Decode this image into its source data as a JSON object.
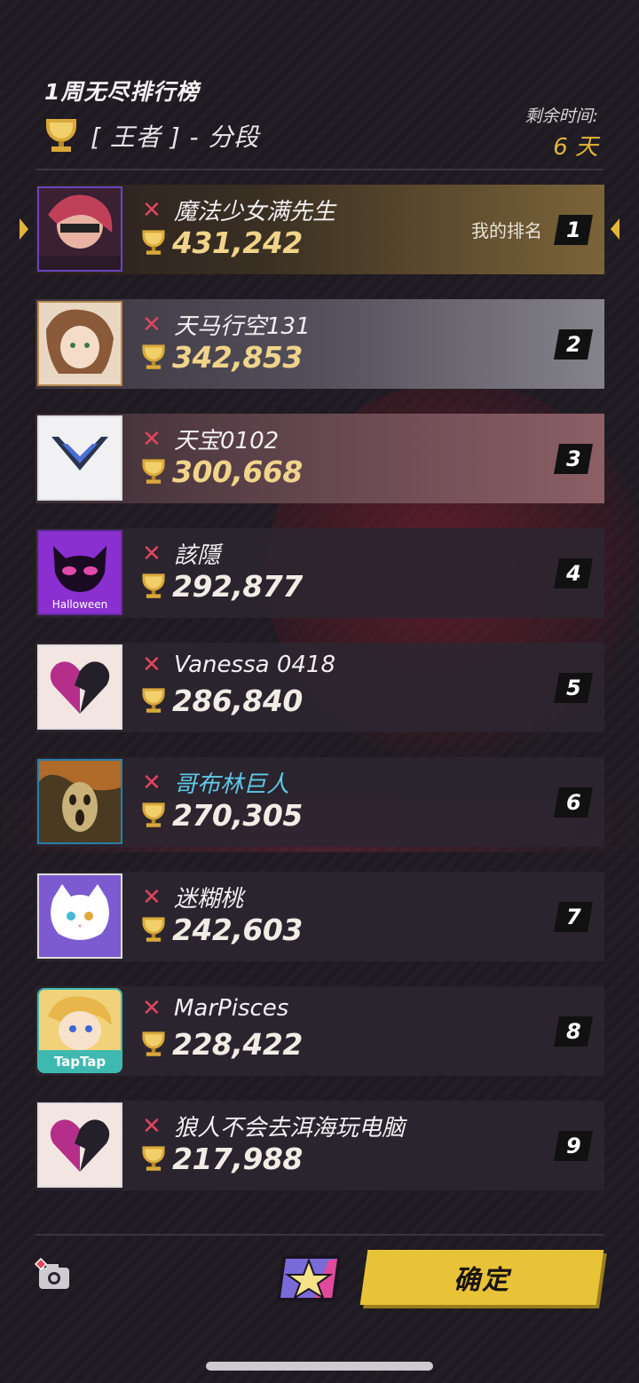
{
  "header": {
    "title": "1周无尽排行榜",
    "tier_label": "[ 王者 ] - 分段",
    "time_label": "剩余时间:",
    "time_value": "6 天"
  },
  "my_rank_label": "我的排名",
  "entries": [
    {
      "rank": "1",
      "name": "魔法少女满先生",
      "score": "431,242"
    },
    {
      "rank": "2",
      "name": "天马行空131",
      "score": "342,853"
    },
    {
      "rank": "3",
      "name": "天宝0102",
      "score": "300,668"
    },
    {
      "rank": "4",
      "name": "該隱",
      "score": "292,877",
      "avatar_text": "Halloween"
    },
    {
      "rank": "5",
      "name": "Vanessa 0418",
      "score": "286,840"
    },
    {
      "rank": "6",
      "name": "哥布林巨人",
      "score": "270,305"
    },
    {
      "rank": "7",
      "name": "迷糊桃",
      "score": "242,603"
    },
    {
      "rank": "8",
      "name": "MarPisces",
      "score": "228,422",
      "avatar_text": "TapTap"
    },
    {
      "rank": "9",
      "name": "狼人不会去洱海玩电脑",
      "score": "217,988"
    }
  ],
  "footer": {
    "confirm_label": "确定"
  },
  "colors": {
    "accent_gold": "#e3b63a",
    "button_yellow": "#e8c338",
    "x_red": "#e0455f",
    "name_cyan": "#5fc8e6"
  },
  "icons": [
    "trophy-icon",
    "x-icon",
    "camera-icon",
    "star-card-icon",
    "arrow-left-icon",
    "arrow-right-icon"
  ]
}
